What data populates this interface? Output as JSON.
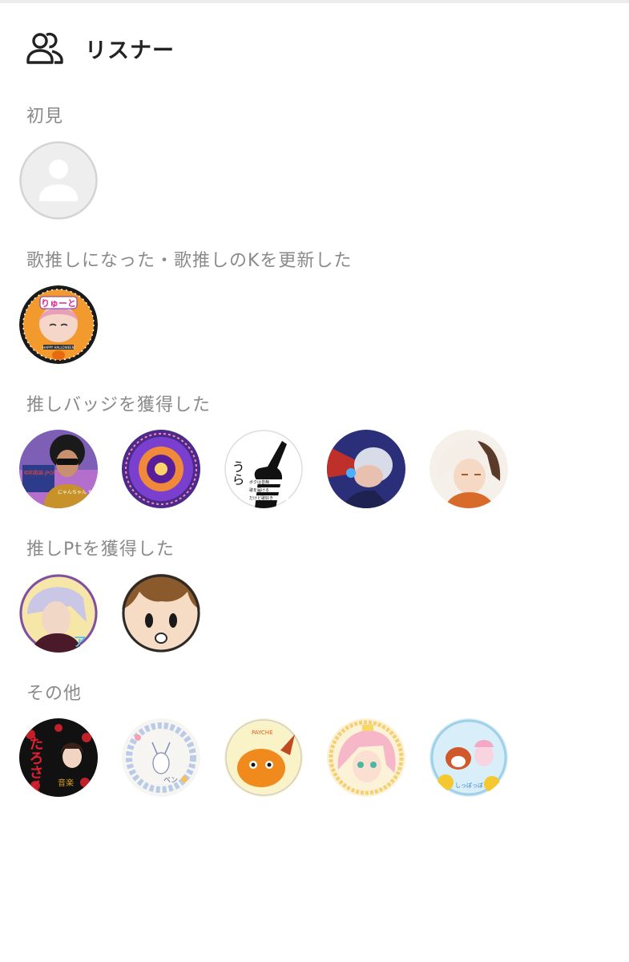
{
  "header": {
    "title": "リスナー",
    "icon": "users-icon"
  },
  "sections": [
    {
      "label": "初見",
      "avatars": [
        {
          "icon": "default-user-icon"
        }
      ]
    },
    {
      "label": "歌推しになった・歌推しのKを更新した",
      "avatars": [
        {
          "banner_text": "りゅーと",
          "ring_text": "HAPPY HALLOWEEN"
        }
      ]
    },
    {
      "label": "推しバッジを獲得した",
      "avatars": [
        {
          "sign_text": "昭和歌謡 JPOP アニソン",
          "bottom_text": "にゃんちゃん もげ"
        },
        {
          "kind": "illustration"
        },
        {
          "vertical_text": "うら",
          "lines_text": [
            "ボクは音痴",
            "歌を届ける",
            "だけど歌好き"
          ]
        },
        {
          "kind": "illustration"
        },
        {
          "kind": "illustration"
        }
      ]
    },
    {
      "label": "推しPtを獲得した",
      "avatars": [
        {
          "side_text": "アス"
        },
        {
          "kind": "illustration"
        }
      ]
    },
    {
      "label": "その他",
      "avatars": [
        {
          "big_text": "たろさく",
          "small_text": "音楽"
        },
        {
          "ring_text": "ベン"
        },
        {
          "top_text": "PAYCHE"
        },
        {
          "kind": "illustration"
        },
        {
          "bottom_text": "しっぽっぽ"
        }
      ]
    }
  ],
  "colors": {
    "label": "#8a8a8a",
    "title": "#222222",
    "placeholder_bg": "#eeeeee",
    "placeholder_fg": "#ffffff"
  }
}
